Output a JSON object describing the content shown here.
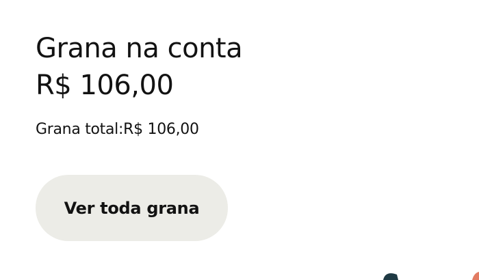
{
  "balance": {
    "title": "Grana na conta",
    "amount": "R$ 106,00",
    "total_label": "Grana total:",
    "total_value": "R$ 106,00"
  },
  "actions": {
    "view_all_label": "Ver toda grana"
  },
  "colors": {
    "text": "#121212",
    "button_bg": "#ecece7",
    "decoration_dark": "#1f3a44",
    "decoration_accent": "#e27c63"
  }
}
